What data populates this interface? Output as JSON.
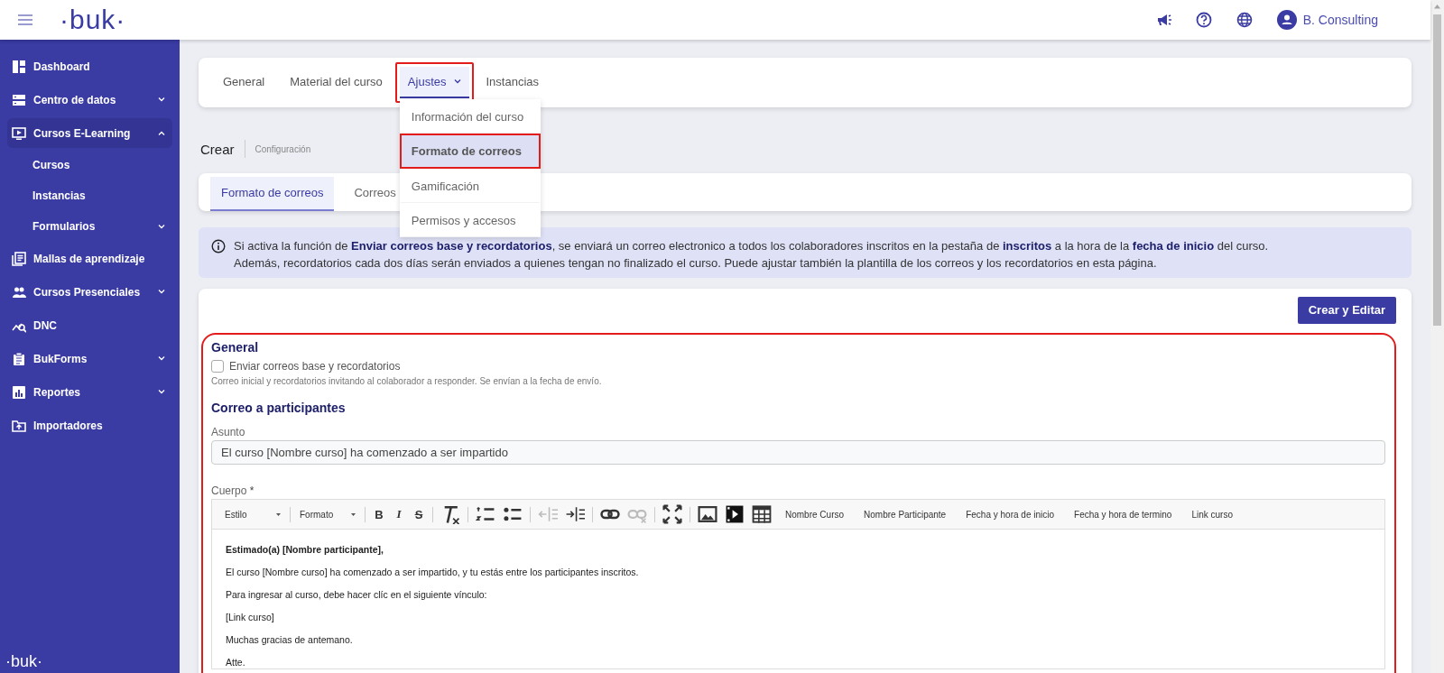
{
  "header": {
    "logo": "·buk·",
    "user": "B. Consulting"
  },
  "sidebar": {
    "items": [
      {
        "label": "Dashboard",
        "selected": false
      },
      {
        "label": "Centro de datos",
        "selected": false,
        "expanded": false
      },
      {
        "label": "Cursos E-Learning",
        "selected": true,
        "expanded": true,
        "children": [
          {
            "label": "Cursos"
          },
          {
            "label": "Instancias"
          },
          {
            "label": "Formularios",
            "expanded": false
          }
        ]
      },
      {
        "label": "Mallas de aprendizaje",
        "selected": false
      },
      {
        "label": "Cursos Presenciales",
        "selected": false,
        "expanded": false
      },
      {
        "label": "DNC",
        "selected": false
      },
      {
        "label": "BukForms",
        "selected": false,
        "expanded": false
      },
      {
        "label": "Reportes",
        "selected": false,
        "expanded": false
      },
      {
        "label": "Importadores",
        "selected": false
      }
    ],
    "footer_logo": "·buk·"
  },
  "tabs": [
    {
      "label": "General",
      "selected": false,
      "highlighted": false
    },
    {
      "label": "Material del curso",
      "selected": false,
      "highlighted": false
    },
    {
      "label": "Ajustes",
      "selected": true,
      "highlighted": true,
      "menu": [
        {
          "label": "Información del curso",
          "selected": false,
          "highlighted": false
        },
        {
          "label": "Formato de correos",
          "selected": true,
          "highlighted": true
        },
        {
          "label": "Gamificación",
          "selected": false,
          "highlighted": false
        },
        {
          "label": "Permisos y accesos",
          "selected": false,
          "highlighted": false
        }
      ]
    },
    {
      "label": "Instancias",
      "selected": false,
      "highlighted": false
    }
  ],
  "breadcrumb": {
    "title": "Crear",
    "subtitle": "Configuración"
  },
  "subtabs": [
    {
      "label": "Formato de correos",
      "selected": true
    },
    {
      "label": "Correos",
      "selected": false
    }
  ],
  "info_banner": [
    "Si activa la función de **Enviar correos base y recordatorios**, se enviará un correo electronico a todos los colaboradores inscritos en la pestaña de **inscritos** a la hora de la **fecha de inicio** del curso.",
    "Además, recordatorios cada dos días serán enviados a quienes tengan no finalizado el curso. Puede ajustar también la plantilla de los correos y los recordatorios en esta página."
  ],
  "primary_button": "Crear y Editar",
  "form": {
    "highlighted": true,
    "title": "General",
    "checkbox": {
      "label": "Enviar correos base y recordatorios",
      "checked": false
    },
    "help": "Correo inicial y recordatorios invitando al colaborador a responder. Se envían a la fecha de envío.",
    "section": "Correo a participantes",
    "subject": {
      "label": "Asunto",
      "value": "El curso [Nombre curso] ha comenzado a ser impartido"
    },
    "body": {
      "label": "Cuerpo",
      "required_mark": "*",
      "dropdowns": [
        "Estilo",
        "Formato"
      ],
      "tools": [
        {
          "kind": "separator"
        },
        {
          "kind": "bold",
          "label": "B",
          "disabled": false
        },
        {
          "kind": "italic",
          "label": "I",
          "disabled": false
        },
        {
          "kind": "strike",
          "label": "S",
          "disabled": false
        },
        {
          "kind": "separator"
        },
        {
          "kind": "clear-format",
          "disabled": false
        },
        {
          "kind": "separator"
        },
        {
          "kind": "numbered-list",
          "disabled": false
        },
        {
          "kind": "bulleted-list",
          "disabled": false
        },
        {
          "kind": "separator"
        },
        {
          "kind": "outdent",
          "disabled": true
        },
        {
          "kind": "indent",
          "disabled": false
        },
        {
          "kind": "separator"
        },
        {
          "kind": "link",
          "disabled": false
        },
        {
          "kind": "unlink",
          "disabled": true
        },
        {
          "kind": "separator"
        },
        {
          "kind": "maximize",
          "disabled": false
        },
        {
          "kind": "separator"
        },
        {
          "kind": "image",
          "disabled": false
        },
        {
          "kind": "video",
          "disabled": false
        },
        {
          "kind": "table",
          "disabled": false
        }
      ],
      "placeholders": [
        "Nombre Curso",
        "Nombre Participante",
        "Fecha y hora de inicio",
        "Fecha y hora de termino",
        "Link curso"
      ],
      "paragraphs": [
        {
          "kind": "greeting",
          "text": "Estimado(a) [Nombre participante],"
        },
        {
          "kind": "text",
          "text": "El curso [Nombre curso] ha comenzado a ser impartido, y tu estás entre los participantes inscritos."
        },
        {
          "kind": "text",
          "text": "Para ingresar al curso, debe hacer clíc en el siguiente vínculo:"
        },
        {
          "kind": "text",
          "text": "[Link curso]"
        },
        {
          "kind": "text",
          "text": "Muchas gracias de antemano."
        },
        {
          "kind": "text",
          "text": "Atte."
        }
      ]
    }
  }
}
